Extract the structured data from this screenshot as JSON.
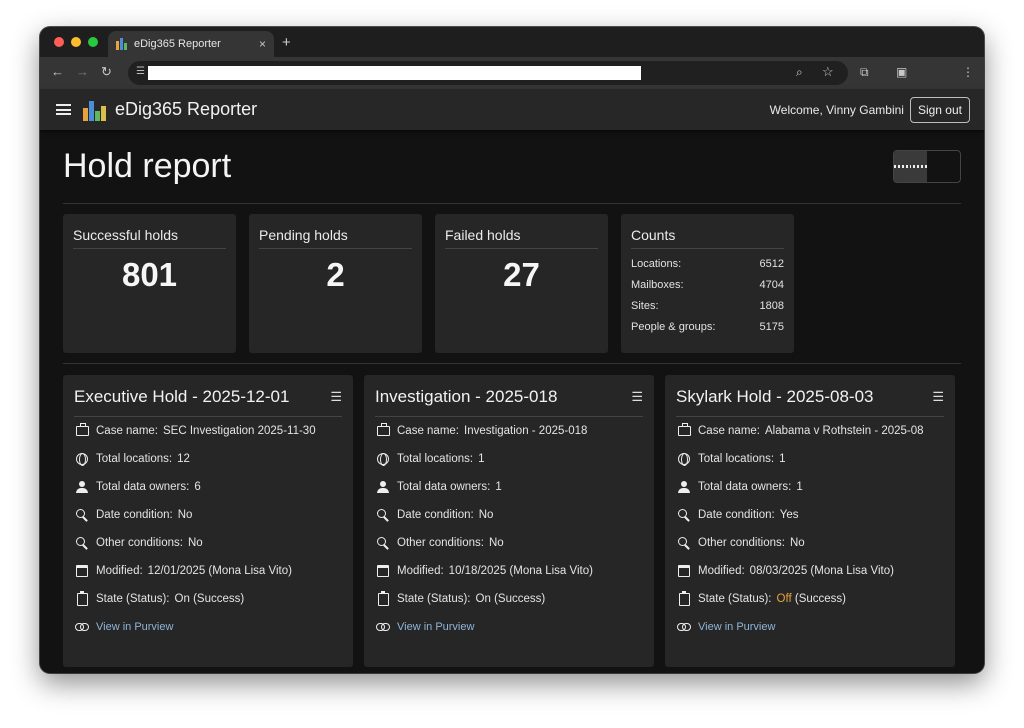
{
  "browser": {
    "tab_title": "eDig365 Reporter",
    "tab_close": "×",
    "new_tab": "+"
  },
  "appbar": {
    "title": "eDig365 Reporter",
    "welcome": "Welcome, Vinny Gambini",
    "signout": "Sign out"
  },
  "page": {
    "title": "Hold report",
    "view_mode": "grid"
  },
  "stats": {
    "successful": {
      "label": "Successful holds",
      "value": "801"
    },
    "pending": {
      "label": "Pending holds",
      "value": "2"
    },
    "failed": {
      "label": "Failed holds",
      "value": "27"
    },
    "counts": {
      "label": "Counts",
      "rows": [
        {
          "label": "Locations:",
          "value": "6512"
        },
        {
          "label": "Mailboxes:",
          "value": "4704"
        },
        {
          "label": "Sites:",
          "value": "1808"
        },
        {
          "label": "People & groups:",
          "value": "5175"
        }
      ]
    }
  },
  "field_labels": {
    "case_name": "Case name:",
    "total_locations": "Total locations:",
    "total_data_owners": "Total data owners:",
    "date_condition": "Date condition:",
    "other_conditions": "Other conditions:",
    "modified": "Modified:",
    "state": "State (Status):",
    "view_link": "View in Purview"
  },
  "holds": [
    {
      "title": "Executive Hold - 2025-12-01",
      "case_name": "SEC Investigation 2025-11-30",
      "total_locations": "12",
      "total_data_owners": "6",
      "date_condition": "No",
      "other_conditions": "No",
      "modified": "12/01/2025 (Mona Lisa Vito)",
      "state": "On",
      "status": "(Success)"
    },
    {
      "title": "Investigation - 2025-018",
      "case_name": "Investigation - 2025-018",
      "total_locations": "1",
      "total_data_owners": "1",
      "date_condition": "No",
      "other_conditions": "No",
      "modified": "10/18/2025 (Mona Lisa Vito)",
      "state": "On",
      "status": "(Success)"
    },
    {
      "title": "Skylark Hold - 2025-08-03",
      "case_name": "Alabama v Rothstein - 2025-08",
      "total_locations": "1",
      "total_data_owners": "1",
      "date_condition": "Yes",
      "other_conditions": "No",
      "modified": "08/03/2025 (Mona Lisa Vito)",
      "state": "Off",
      "status": "(Success)"
    }
  ],
  "colors": {
    "accent_link": "#8fb5d8",
    "state_off": "#e8a33d",
    "card_bg": "#262626",
    "app_bg": "#121212"
  }
}
